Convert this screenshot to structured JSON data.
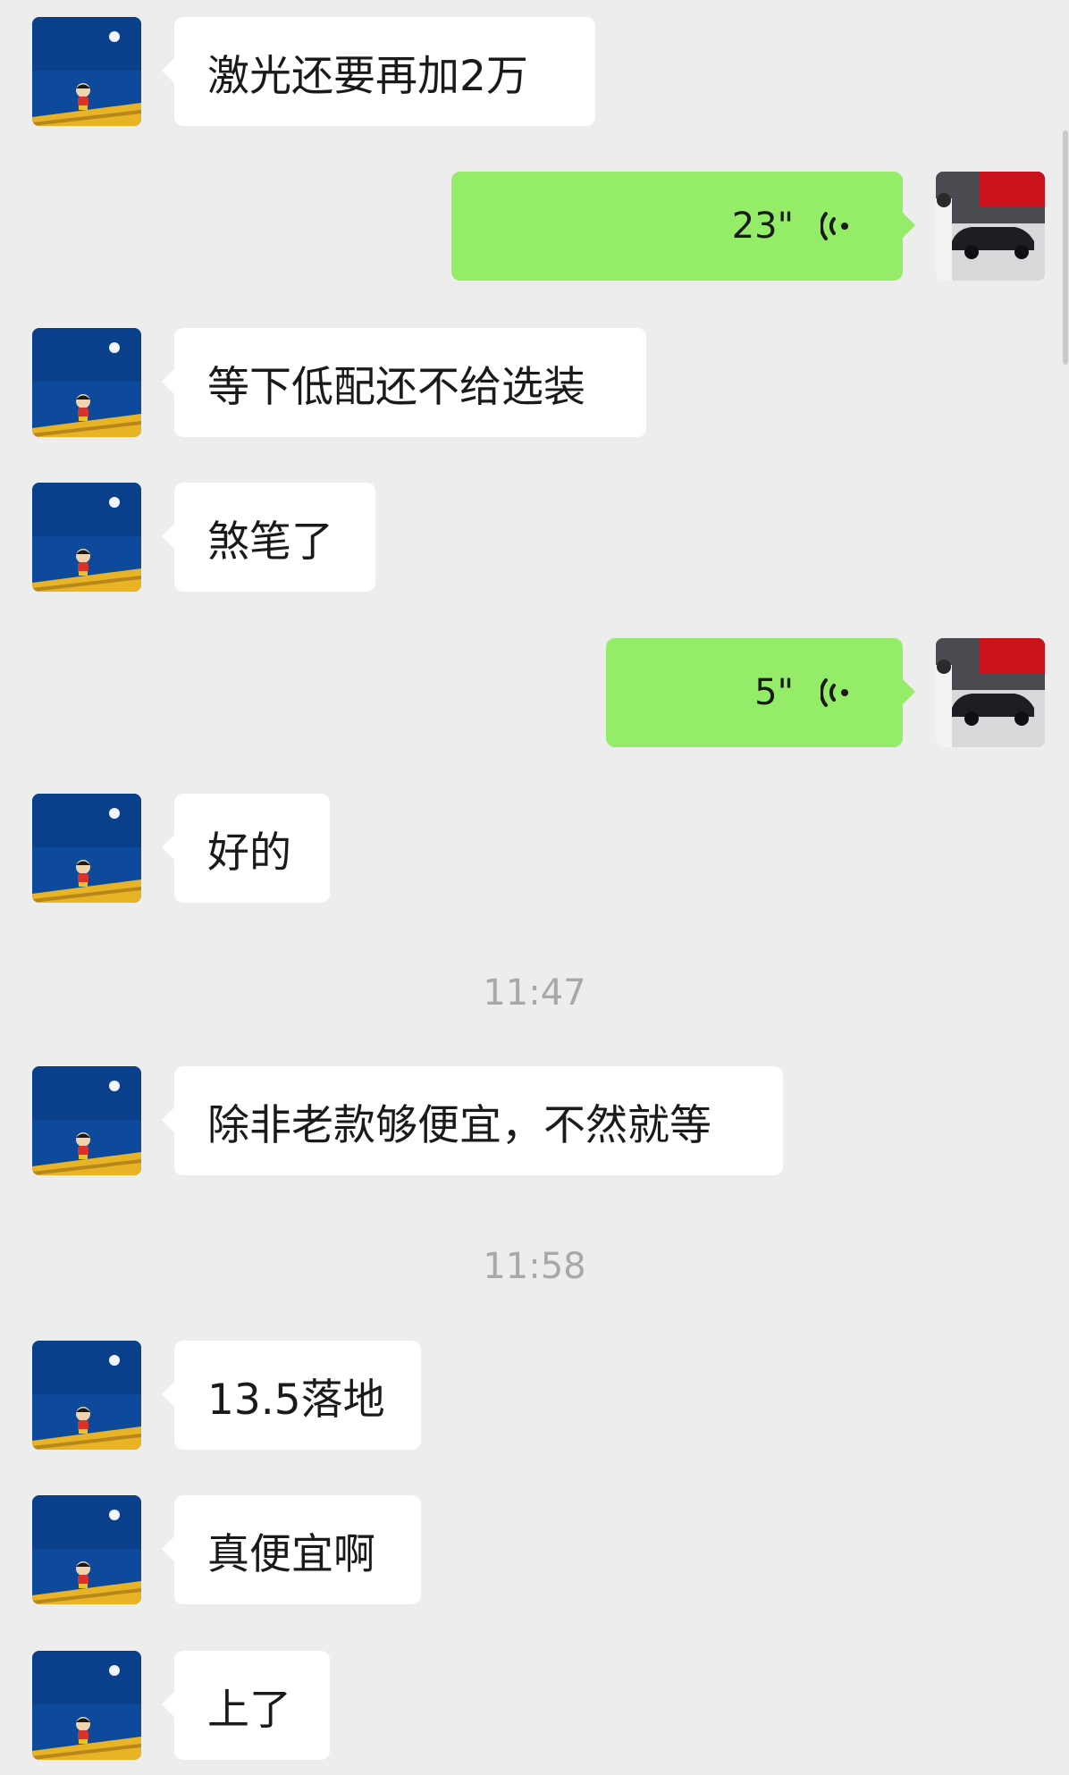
{
  "messages": [
    {
      "side": "left",
      "text": "激光还要再加2万"
    },
    {
      "side": "right",
      "type": "voice",
      "duration": "23\""
    },
    {
      "side": "left",
      "text": "等下低配还不给选装"
    },
    {
      "side": "left",
      "text": "煞笔了"
    },
    {
      "side": "right",
      "type": "voice",
      "duration": "5\""
    },
    {
      "side": "left",
      "text": "好的"
    },
    {
      "type": "time",
      "text": "11:47"
    },
    {
      "side": "left",
      "text": "除非老款够便宜，不然就等"
    },
    {
      "type": "time",
      "text": "11:58"
    },
    {
      "side": "left",
      "text": "13.5落地"
    },
    {
      "side": "left",
      "text": "真便宜啊"
    },
    {
      "side": "left",
      "text": "上了"
    }
  ],
  "colors": {
    "background": "#ededed",
    "incoming_bubble": "#ffffff",
    "outgoing_bubble": "#95ec69",
    "timestamp": "#a8a8a8"
  },
  "icons": {
    "contact_avatar": "cartoon-boy-avatar",
    "own_avatar": "car-photo-avatar",
    "voice": "voice-wave-icon"
  }
}
